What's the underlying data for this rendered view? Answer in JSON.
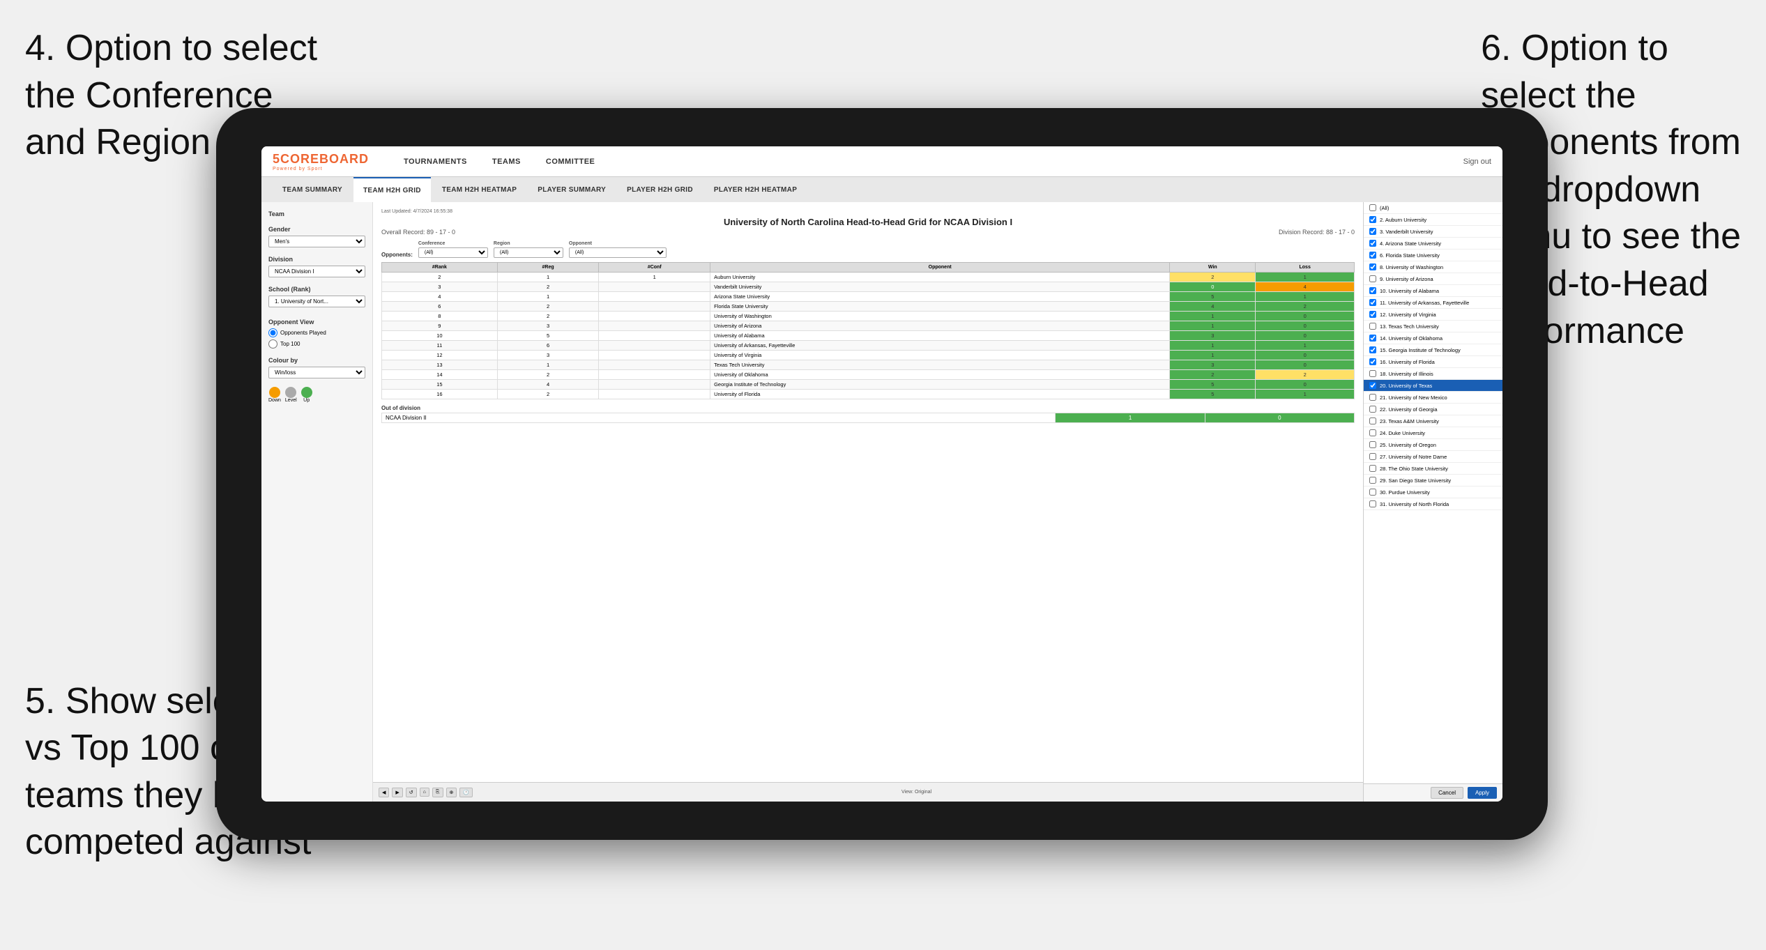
{
  "annotations": {
    "ann1": "4. Option to select\nthe Conference\nand Region",
    "ann2": "6. Option to\nselect the\nOpponents from\nthe dropdown\nmenu to see the\nHead-to-Head\nperformance",
    "ann3": "5. Show selection\nvs Top 100 or just\nteams they have\ncompeted against"
  },
  "navbar": {
    "logo": "5COREBOARD",
    "logo_sub": "Powered by Sport",
    "items": [
      "TOURNAMENTS",
      "TEAMS",
      "COMMITTEE"
    ],
    "right": "Sign out"
  },
  "subnav": {
    "items": [
      "TEAM SUMMARY",
      "TEAM H2H GRID",
      "TEAM H2H HEATMAP",
      "PLAYER SUMMARY",
      "PLAYER H2H GRID",
      "PLAYER H2H HEATMAP"
    ],
    "active": "TEAM H2H GRID"
  },
  "left_panel": {
    "team_label": "Team",
    "gender_label": "Gender",
    "gender_value": "Men's",
    "division_label": "Division",
    "division_value": "NCAA Division I",
    "school_label": "School (Rank)",
    "school_value": "1. University of Nort...",
    "opponent_view_label": "Opponent View",
    "radio_options": [
      "Opponents Played",
      "Top 100"
    ],
    "radio_selected": "Opponents Played",
    "colour_by_label": "Colour by",
    "colour_value": "Win/loss",
    "legend": [
      {
        "label": "Down",
        "color": "#f59c00"
      },
      {
        "label": "Level",
        "color": "#aaa"
      },
      {
        "label": "Up",
        "color": "#4caf50"
      }
    ]
  },
  "report": {
    "last_updated": "Last Updated: 4/7/2024 16:55:38",
    "title": "University of North Carolina Head-to-Head Grid for NCAA Division I",
    "overall_record": "Overall Record: 89 - 17 - 0",
    "division_record": "Division Record: 88 - 17 - 0"
  },
  "filters": {
    "opponents_label": "Opponents:",
    "conference_label": "Conference",
    "conference_value": "(All)",
    "region_label": "Region",
    "region_value": "(All)",
    "opponent_label": "Opponent",
    "opponent_value": "(All)"
  },
  "table": {
    "headers": [
      "#Rank",
      "#Reg",
      "#Conf",
      "Opponent",
      "Win",
      "Loss"
    ],
    "rows": [
      {
        "rank": "2",
        "reg": "1",
        "conf": "1",
        "opponent": "Auburn University",
        "win": "2",
        "loss": "1",
        "win_color": "yellow",
        "loss_color": "green"
      },
      {
        "rank": "3",
        "reg": "2",
        "conf": "",
        "opponent": "Vanderbilt University",
        "win": "0",
        "loss": "4",
        "win_color": "green",
        "loss_color": "orange"
      },
      {
        "rank": "4",
        "reg": "1",
        "conf": "",
        "opponent": "Arizona State University",
        "win": "5",
        "loss": "1",
        "win_color": "green",
        "loss_color": "green"
      },
      {
        "rank": "6",
        "reg": "2",
        "conf": "",
        "opponent": "Florida State University",
        "win": "4",
        "loss": "2",
        "win_color": "green",
        "loss_color": "green"
      },
      {
        "rank": "8",
        "reg": "2",
        "conf": "",
        "opponent": "University of Washington",
        "win": "1",
        "loss": "0",
        "win_color": "green",
        "loss_color": "green"
      },
      {
        "rank": "9",
        "reg": "3",
        "conf": "",
        "opponent": "University of Arizona",
        "win": "1",
        "loss": "0",
        "win_color": "green",
        "loss_color": "green"
      },
      {
        "rank": "10",
        "reg": "5",
        "conf": "",
        "opponent": "University of Alabama",
        "win": "3",
        "loss": "0",
        "win_color": "green",
        "loss_color": "green"
      },
      {
        "rank": "11",
        "reg": "6",
        "conf": "",
        "opponent": "University of Arkansas, Fayetteville",
        "win": "1",
        "loss": "1",
        "win_color": "green",
        "loss_color": "green"
      },
      {
        "rank": "12",
        "reg": "3",
        "conf": "",
        "opponent": "University of Virginia",
        "win": "1",
        "loss": "0",
        "win_color": "green",
        "loss_color": "green"
      },
      {
        "rank": "13",
        "reg": "1",
        "conf": "",
        "opponent": "Texas Tech University",
        "win": "3",
        "loss": "0",
        "win_color": "green",
        "loss_color": "green"
      },
      {
        "rank": "14",
        "reg": "2",
        "conf": "",
        "opponent": "University of Oklahoma",
        "win": "2",
        "loss": "2",
        "win_color": "green",
        "loss_color": "yellow"
      },
      {
        "rank": "15",
        "reg": "4",
        "conf": "",
        "opponent": "Georgia Institute of Technology",
        "win": "5",
        "loss": "0",
        "win_color": "green",
        "loss_color": "green"
      },
      {
        "rank": "16",
        "reg": "2",
        "conf": "",
        "opponent": "University of Florida",
        "win": "5",
        "loss": "1",
        "win_color": "green",
        "loss_color": "green"
      }
    ]
  },
  "out_of_division": {
    "label": "Out of division",
    "rows": [
      {
        "division": "NCAA Division II",
        "win": "1",
        "loss": "0",
        "win_color": "green",
        "loss_color": "green"
      }
    ]
  },
  "dropdown": {
    "items": [
      {
        "id": "all",
        "label": "(All)",
        "checked": false,
        "selected": false
      },
      {
        "id": "2",
        "label": "2. Auburn University",
        "checked": true,
        "selected": false
      },
      {
        "id": "3",
        "label": "3. Vanderbilt University",
        "checked": true,
        "selected": false
      },
      {
        "id": "4",
        "label": "4. Arizona State University",
        "checked": true,
        "selected": false
      },
      {
        "id": "6",
        "label": "6. Florida State University",
        "checked": true,
        "selected": false
      },
      {
        "id": "8",
        "label": "8. University of Washington",
        "checked": true,
        "selected": false
      },
      {
        "id": "9",
        "label": "9. University of Arizona",
        "checked": false,
        "selected": false
      },
      {
        "id": "10",
        "label": "10. University of Alabama",
        "checked": true,
        "selected": false
      },
      {
        "id": "11",
        "label": "11. University of Arkansas, Fayetteville",
        "checked": true,
        "selected": false
      },
      {
        "id": "12",
        "label": "12. University of Virginia",
        "checked": true,
        "selected": false
      },
      {
        "id": "13",
        "label": "13. Texas Tech University",
        "checked": false,
        "selected": false
      },
      {
        "id": "14",
        "label": "14. University of Oklahoma",
        "checked": true,
        "selected": false
      },
      {
        "id": "15",
        "label": "15. Georgia Institute of Technology",
        "checked": true,
        "selected": false
      },
      {
        "id": "16",
        "label": "16. University of Florida",
        "checked": true,
        "selected": false
      },
      {
        "id": "18",
        "label": "18. University of Illinois",
        "checked": false,
        "selected": false
      },
      {
        "id": "20",
        "label": "20. University of Texas",
        "checked": true,
        "selected": true
      },
      {
        "id": "21",
        "label": "21. University of New Mexico",
        "checked": false,
        "selected": false
      },
      {
        "id": "22",
        "label": "22. University of Georgia",
        "checked": false,
        "selected": false
      },
      {
        "id": "23",
        "label": "23. Texas A&M University",
        "checked": false,
        "selected": false
      },
      {
        "id": "24",
        "label": "24. Duke University",
        "checked": false,
        "selected": false
      },
      {
        "id": "25",
        "label": "25. University of Oregon",
        "checked": false,
        "selected": false
      },
      {
        "id": "27",
        "label": "27. University of Notre Dame",
        "checked": false,
        "selected": false
      },
      {
        "id": "28",
        "label": "28. The Ohio State University",
        "checked": false,
        "selected": false
      },
      {
        "id": "29",
        "label": "29. San Diego State University",
        "checked": false,
        "selected": false
      },
      {
        "id": "30",
        "label": "30. Purdue University",
        "checked": false,
        "selected": false
      },
      {
        "id": "31",
        "label": "31. University of North Florida",
        "checked": false,
        "selected": false
      }
    ],
    "cancel_label": "Cancel",
    "apply_label": "Apply"
  },
  "toolbar": {
    "view_label": "View: Original"
  }
}
